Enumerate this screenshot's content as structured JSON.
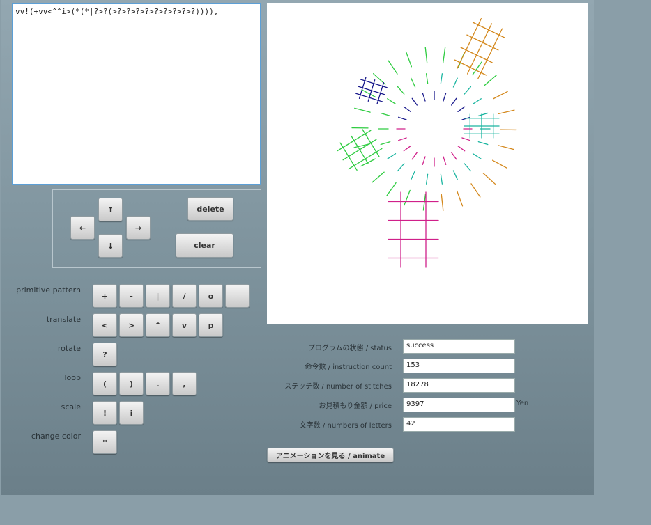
{
  "editor": {
    "code": "vv!(+vv<^^i>(*(*|?>?(>?>?>?>?>?>?>?>?>?)))),"
  },
  "pad": {
    "up": "↑",
    "left": "←",
    "right": "→",
    "down": "↓",
    "delete": "delete",
    "clear": "clear"
  },
  "palette": {
    "primitive_label": "primitive pattern",
    "primitive": [
      "+",
      "-",
      "|",
      "/",
      "o",
      ""
    ],
    "translate_label": "translate",
    "translate": [
      "<",
      ">",
      "^",
      "v",
      "p"
    ],
    "rotate_label": "rotate",
    "rotate": [
      "?"
    ],
    "loop_label": "loop",
    "loop": [
      "(",
      ")",
      ".",
      ","
    ],
    "scale_label": "scale",
    "scale": [
      "!",
      "i"
    ],
    "color_label": "change color",
    "color": [
      "*"
    ]
  },
  "status": {
    "status_label": "プログラムの状態 / status",
    "status_value": "success",
    "instr_label": "命令数 / instruction count",
    "instr_value": "153",
    "stitch_label": "ステッチ数 / number of stitches",
    "stitch_value": "18278",
    "price_label": "お見積もり金額 / price",
    "price_value": "9397",
    "price_unit": "Yen",
    "letters_label": "文字数 / numbers of letters",
    "letters_value": "42"
  },
  "animate_label": "アニメーションを見る / animate",
  "colors": {
    "green": "#2ecc40",
    "orange": "#d4881c",
    "navy": "#1a1a8c",
    "magenta": "#d0208a",
    "teal": "#1ab5a0",
    "editor_border": "#5c9fd6"
  }
}
